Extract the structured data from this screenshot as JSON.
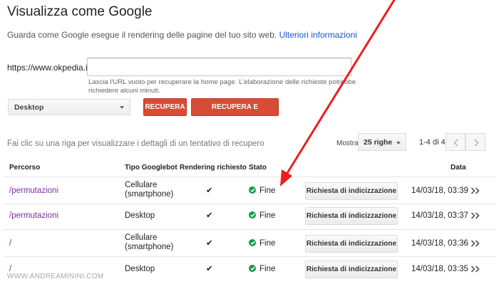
{
  "header": {
    "title": "Visualizza come Google",
    "subtitle": "Guarda come Google esegue il rendering delle pagine del tuo sito web.",
    "more_info_link": "Ulteriori informazioni"
  },
  "fetch_form": {
    "url_prefix": "https://www.okpedia.it/",
    "url_value": "",
    "hint": "Lascia l'URL vuoto per recuperare la home page. L'elaborazione delle richieste potrebbe richiedere alcuni minuti.",
    "device_selected": "Desktop",
    "fetch_button": "RECUPERA",
    "fetch_render_button": "RECUPERA E VISUALIZZA"
  },
  "table_controls": {
    "hint": "Fai clic su una riga per visualizzare i dettagli di un tentativo di recupero",
    "show_label": "Mostra",
    "rows_selected": "25 righe",
    "pagination": "1-4 di 4"
  },
  "table": {
    "headers": {
      "path": "Percorso",
      "googlebot": "Tipo Googlebot",
      "rendering": "Rendering richiesto",
      "status": "Stato",
      "date": "Data"
    },
    "rows": [
      {
        "path": "/permutazioni",
        "googlebot_line1": "Cellulare",
        "googlebot_line2": "(smartphone)",
        "rendering": "✔",
        "status": "Fine",
        "action": "Richiesta di indicizzazione",
        "date": "14/03/18, 03:39"
      },
      {
        "path": "/permutazioni",
        "googlebot_line1": "Desktop",
        "googlebot_line2": "",
        "rendering": "✔",
        "status": "Fine",
        "action": "Richiesta di indicizzazione",
        "date": "14/03/18, 03:37"
      },
      {
        "path": "/",
        "googlebot_line1": "Cellulare",
        "googlebot_line2": "(smartphone)",
        "rendering": "✔",
        "status": "Fine",
        "action": "Richiesta di indicizzazione",
        "date": "14/03/18, 03:36"
      },
      {
        "path": "/",
        "googlebot_line1": "Desktop",
        "googlebot_line2": "",
        "rendering": "✔",
        "status": "Fine",
        "action": "Richiesta di indicizzazione",
        "date": "14/03/18, 03:35"
      }
    ]
  },
  "watermark": "WWW.ANDREAMININI.COM",
  "colors": {
    "accent_red": "#d84b37",
    "link_blue": "#1a55c9",
    "path_purple": "#7b2fa3",
    "status_green": "#109a4c",
    "annotation_arrow": "#ee1c1c"
  },
  "icons": {
    "status": "check-circle-icon",
    "row_expand": "double-chevron-right-icon",
    "pager_prev": "chevron-left-icon",
    "pager_next": "chevron-right-icon"
  }
}
